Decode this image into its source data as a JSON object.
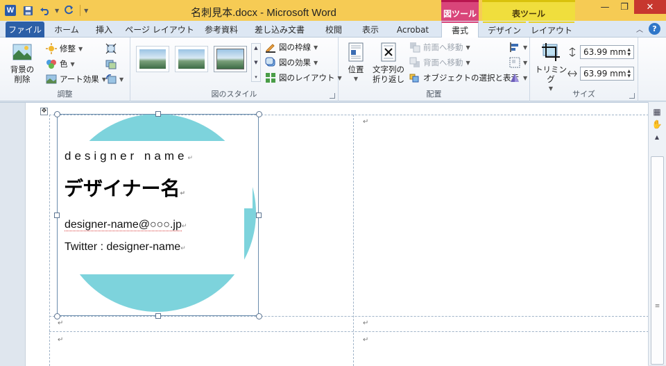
{
  "window": {
    "title": "名刺見本.docx - Microsoft Word",
    "context_tools": {
      "picture": "図ツール",
      "table": "表ツール"
    },
    "controls": {
      "minimize": "—",
      "restore": "❐",
      "close": "✕"
    }
  },
  "qat": {
    "app_icon": "W",
    "save_icon": "save-icon",
    "undo_icon": "undo-icon",
    "redo_icon": "redo-icon"
  },
  "tabs": [
    {
      "label": "ファイル"
    },
    {
      "label": "ホーム"
    },
    {
      "label": "挿入"
    },
    {
      "label": "ページ レイアウト"
    },
    {
      "label": "参考資料"
    },
    {
      "label": "差し込み文書"
    },
    {
      "label": "校閲"
    },
    {
      "label": "表示"
    },
    {
      "label": "Acrobat"
    },
    {
      "label": "書式"
    },
    {
      "label": "デザイン"
    },
    {
      "label": "レイアウト"
    }
  ],
  "ribbon": {
    "adjust": {
      "label": "調整",
      "remove_bg": "背景の\n削除",
      "remove_bg_1": "背景の",
      "remove_bg_2": "削除",
      "corrections": "修整",
      "color": "色",
      "art_effects": "アート効果"
    },
    "styles": {
      "label": "図のスタイル",
      "border": "図の枠線",
      "effects": "図の効果",
      "layout": "図のレイアウト"
    },
    "arrange": {
      "label": "配置",
      "position": "位置",
      "wrap_1": "文字列の",
      "wrap_2": "折り返し",
      "bring_forward": "前面へ移動",
      "send_backward": "背面へ移動",
      "selection_pane": "オブジェクトの選択と表示"
    },
    "size": {
      "label": "サイズ",
      "crop": "トリミング",
      "height": "63.99 mm",
      "width": "63.99 mm"
    }
  },
  "card": {
    "designer_en": "designer name",
    "designer_jp": "デザイナー名",
    "email": "designer-name@○○○.jp",
    "twitter": "Twitter : designer-name",
    "circle_color": "#7dd3dc"
  },
  "marks": {
    "para": "↵"
  }
}
